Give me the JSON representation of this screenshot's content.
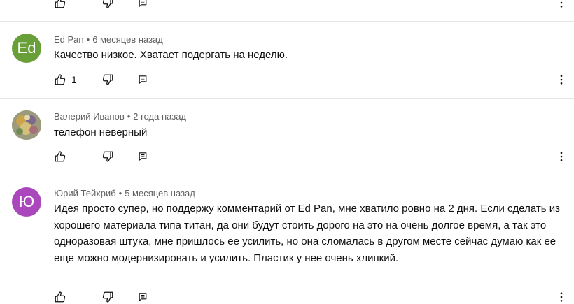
{
  "comments": [
    {
      "author": "Ed Pan",
      "avatar_initials": "Ed",
      "avatar_color": "#689f38",
      "time": "6 месяцев назад",
      "text": "Качество низкое. Хватает подергать на неделю.",
      "likes": "1"
    },
    {
      "author": "Валерий Иванов",
      "avatar_initials": "",
      "time": "2 года назад",
      "text": "телефон неверный",
      "likes": ""
    },
    {
      "author": "Юрий Тейхриб",
      "avatar_initials": "Ю",
      "avatar_color": "#ab47bc",
      "time": "5 месяцев назад",
      "text": "Идея просто супер, но поддержу комментарий от Ed Pan, мне хватило ровно на 2 дня. Если сделать из хорошего материала типа титан, да они будут стоить дорого на это на очень долгое время, а так это одноразовая штука, мне пришлось ее усилить, но она сломалась в другом месте сейчас думаю как ее еще можно модернизировать и усилить. Пластик у нее очень хлипкий.",
      "likes": ""
    }
  ],
  "separator": "•",
  "colors": {
    "text": "#0f0f0f",
    "meta": "#606060",
    "divider": "#e5e5e5"
  },
  "icons": [
    "thumb-up-icon",
    "thumb-down-icon",
    "reply-icon",
    "more-vert-icon"
  ]
}
